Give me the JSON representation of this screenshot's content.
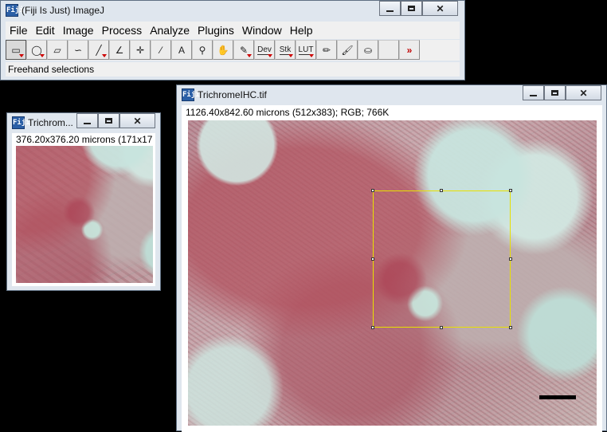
{
  "imagej": {
    "title": "(Fiji Is Just) ImageJ",
    "app_icon": "fiji-icon",
    "menus": [
      "File",
      "Edit",
      "Image",
      "Process",
      "Analyze",
      "Plugins",
      "Window",
      "Help"
    ],
    "tools": [
      {
        "name": "rectangle-tool-icon",
        "glyph": "▭",
        "label": ""
      },
      {
        "name": "oval-tool-icon",
        "glyph": "◯",
        "label": ""
      },
      {
        "name": "polygon-tool-icon",
        "glyph": "▱",
        "label": ""
      },
      {
        "name": "freehand-tool-icon",
        "glyph": "∽",
        "label": ""
      },
      {
        "name": "line-tool-icon",
        "glyph": "╱",
        "label": ""
      },
      {
        "name": "angle-tool-icon",
        "glyph": "∠",
        "label": ""
      },
      {
        "name": "point-tool-icon",
        "glyph": "✛",
        "label": ""
      },
      {
        "name": "wand-tool-icon",
        "glyph": "⁄",
        "label": ""
      },
      {
        "name": "text-tool-icon",
        "glyph": "A",
        "label": ""
      },
      {
        "name": "magnifier-tool-icon",
        "glyph": "⚲",
        "label": ""
      },
      {
        "name": "hand-tool-icon",
        "glyph": "✋",
        "label": ""
      },
      {
        "name": "dropper-tool-icon",
        "glyph": "✎",
        "label": ""
      },
      {
        "name": "dev-tool",
        "glyph": "",
        "label": "Dev"
      },
      {
        "name": "stk-tool",
        "glyph": "",
        "label": "Stk"
      },
      {
        "name": "lut-tool",
        "glyph": "",
        "label": "LUT"
      },
      {
        "name": "pencil-tool-icon",
        "glyph": "✏",
        "label": ""
      },
      {
        "name": "brush-tool-icon",
        "glyph": "🖌",
        "label": ""
      },
      {
        "name": "flood-fill-tool-icon",
        "glyph": "⛀",
        "label": ""
      },
      {
        "name": "blank-tool",
        "glyph": "",
        "label": ""
      },
      {
        "name": "more-tools-icon",
        "glyph": "»",
        "label": ""
      }
    ],
    "status": "Freehand selections"
  },
  "small_window": {
    "title": "Trichrom...",
    "info": "376.20x376.20 microns (171x17"
  },
  "large_window": {
    "title": "TrichromeIHC.tif",
    "info": "1126.40x842.60 microns (512x383); RGB; 766K"
  },
  "colors": {
    "roi": "#e8e000",
    "accent_red": "#c00000"
  }
}
